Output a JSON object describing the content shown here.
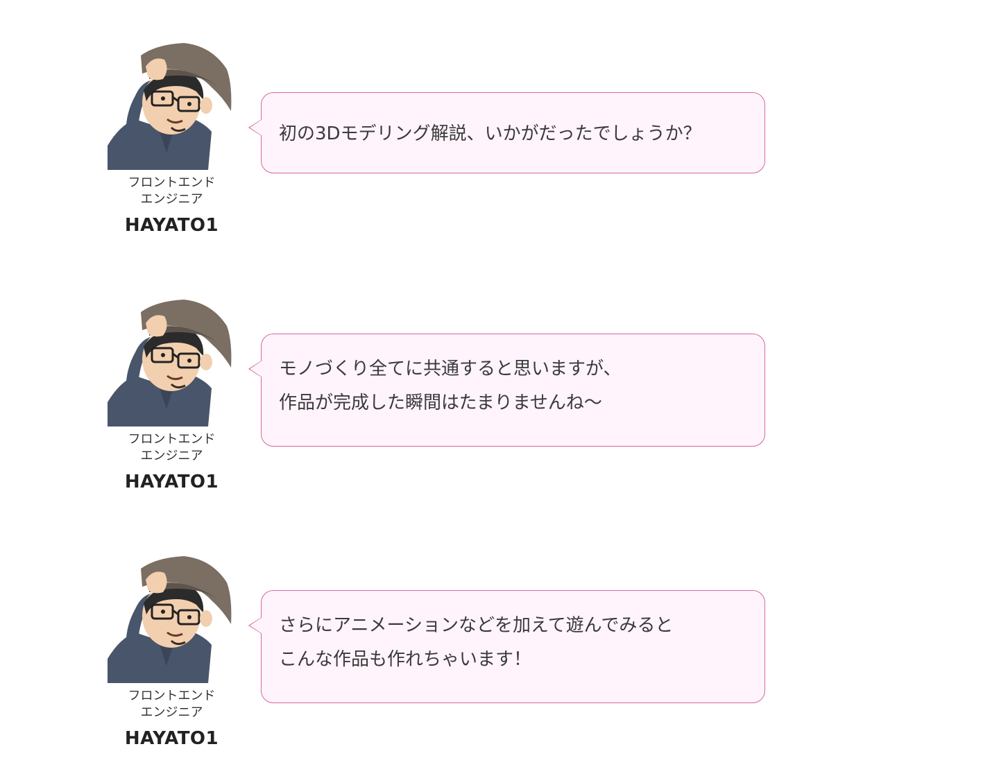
{
  "speaker": {
    "role_line1": "フロントエンド",
    "role_line2": "エンジニア",
    "name": "HAYATO1"
  },
  "colors": {
    "bubble_border": "#d5669e",
    "bubble_fill": "#fff4fc",
    "hat": "#7b6e63",
    "shirt": "#48556b"
  },
  "messages": [
    {
      "lines": [
        "初の3Dモデリング解説、いかがだったでしょうか？"
      ]
    },
    {
      "lines": [
        "モノづくり全てに共通すると思いますが、",
        "作品が完成した瞬間はたまりませんね〜"
      ]
    },
    {
      "lines": [
        "さらにアニメーションなどを加えて遊んでみると",
        "こんな作品も作れちゃいます！"
      ]
    }
  ]
}
